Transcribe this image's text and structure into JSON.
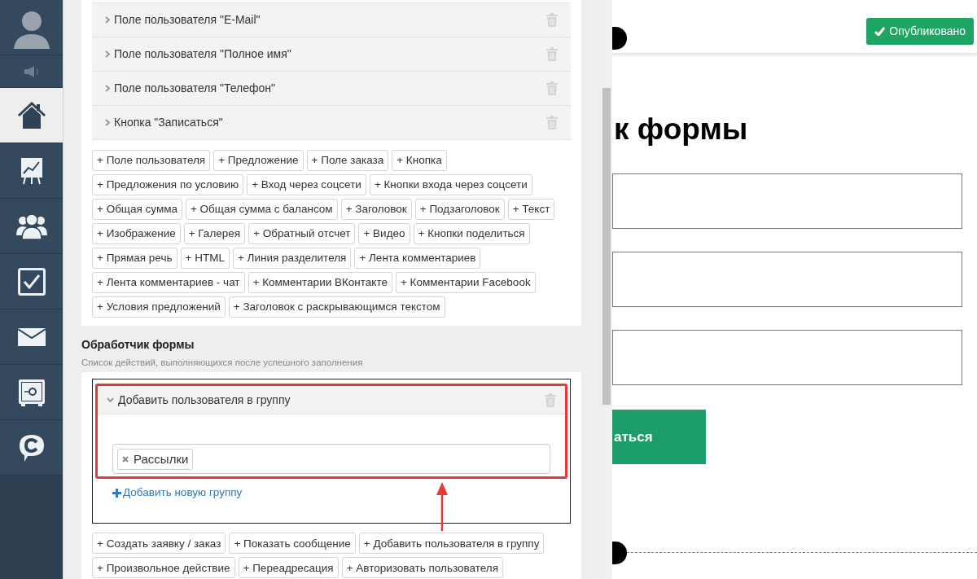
{
  "sidebar": {
    "items": [
      {
        "kind": "avatar",
        "selected": false
      },
      {
        "kind": "speaker",
        "selected": false
      },
      {
        "kind": "home",
        "selected": true
      },
      {
        "kind": "chart",
        "selected": false
      },
      {
        "kind": "users",
        "selected": false
      },
      {
        "kind": "tasks",
        "selected": false
      },
      {
        "kind": "mail",
        "selected": false
      },
      {
        "kind": "safe",
        "selected": false
      },
      {
        "kind": "chat",
        "selected": false
      }
    ]
  },
  "form_fields": [
    {
      "label": "Поле пользователя \"E-Mail\"",
      "expanded": false
    },
    {
      "label": "Поле пользователя \"Полное имя\"",
      "expanded": false
    },
    {
      "label": "Поле пользователя \"Телефон\"",
      "expanded": false
    },
    {
      "label": "Кнопка \"Записаться\"",
      "expanded": false
    }
  ],
  "add_field_buttons": [
    "+ Поле пользователя",
    "+ Предложение",
    "+ Поле заказа",
    "+ Кнопка",
    "+ Предложения по условию",
    "+ Вход через соцсети",
    "+ Кнопки входа через соцсети",
    "+ Общая сумма",
    "+ Общая сумма с балансом",
    "+ Заголовок",
    "+ Подзаголовок",
    "+ Текст",
    "+ Изображение",
    "+ Галерея",
    "+ Обратный отсчет",
    "+ Видео",
    "+ Кнопки поделиться",
    "+ Прямая речь",
    "+ HTML",
    "+ Линия разделителя",
    "+ Лента комментариев",
    "+ Лента комментариев - чат",
    "+ Комментарии ВКонтакте",
    "+ Комментарии Facebook",
    "+ Условия предложений",
    "+ Заголовок с раскрывающимся текстом"
  ],
  "handler": {
    "title": "Обработчик формы",
    "subtitle": "Список действий, выполняющихся после успешного заполнения",
    "actions": [
      {
        "label": "Добавить пользователя в группу",
        "expanded": true,
        "tags": [
          "Рассылки"
        ],
        "add_link": "Добавить новую группу"
      }
    ],
    "add_action_buttons": [
      "+ Создать заявку / заказ",
      "+ Показать сообщение",
      "+ Добавить пользователя в группу",
      "+ Произвольное действие",
      "+ Переадресация",
      "+ Авторизовать пользователя"
    ]
  },
  "preview": {
    "publish_button": "Опубликовано",
    "heading": "к формы",
    "submit_label": "аться"
  }
}
